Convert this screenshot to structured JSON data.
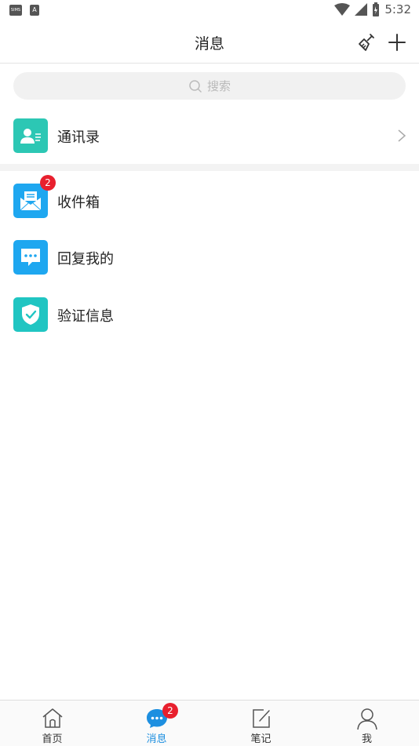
{
  "status_bar": {
    "time": "5:32",
    "left_badge_1": "SIMS",
    "left_badge_2": "A"
  },
  "header": {
    "title": "消息"
  },
  "search": {
    "placeholder": "搜索"
  },
  "contacts": {
    "label": "通讯录",
    "icon_color": "#2cc7b4"
  },
  "items": [
    {
      "label": "收件箱",
      "icon": "mail-icon",
      "icon_color": "#1ea7f0",
      "badge": "2"
    },
    {
      "label": "回复我的",
      "icon": "chat-bubble-icon",
      "icon_color": "#1ea7f0"
    },
    {
      "label": "验证信息",
      "icon": "shield-check-icon",
      "icon_color": "#20c5c2"
    }
  ],
  "bottom_nav": {
    "tabs": [
      {
        "label": "首页",
        "icon": "home-icon",
        "active": false
      },
      {
        "label": "消息",
        "icon": "message-icon",
        "active": true,
        "badge": "2"
      },
      {
        "label": "笔记",
        "icon": "note-icon",
        "active": false
      },
      {
        "label": "我",
        "icon": "person-icon",
        "active": false
      }
    ]
  },
  "colors": {
    "accent": "#1d8fe0",
    "badge": "#e8202e",
    "teal": "#2cc7b4"
  }
}
